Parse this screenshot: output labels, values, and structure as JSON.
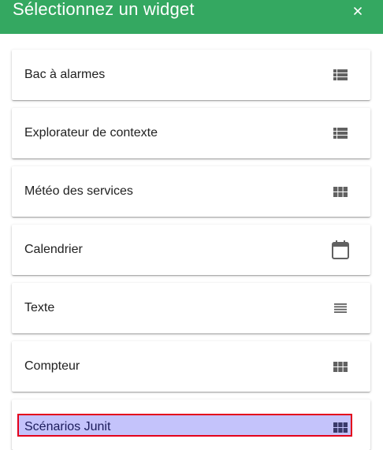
{
  "dialog": {
    "title": "Sélectionnez un widget",
    "close_icon": "close-icon",
    "close_label": "×"
  },
  "colors": {
    "header_bg": "#34a861",
    "highlight_fill": "#c4c3fb",
    "highlight_border": "#e4001b",
    "icon_gray": "#616161"
  },
  "widgets": [
    {
      "label": "Bac à alarmes",
      "icon": "view-list-icon"
    },
    {
      "label": "Explorateur de contexte",
      "icon": "view-list-icon"
    },
    {
      "label": "Météo des services",
      "icon": "view-module-icon"
    },
    {
      "label": "Calendrier",
      "icon": "calendar-icon"
    },
    {
      "label": "Texte",
      "icon": "text-lines-icon"
    },
    {
      "label": "Compteur",
      "icon": "view-module-icon"
    },
    {
      "label": "Scénarios Junit",
      "icon": "view-module-icon",
      "selected": true
    }
  ]
}
